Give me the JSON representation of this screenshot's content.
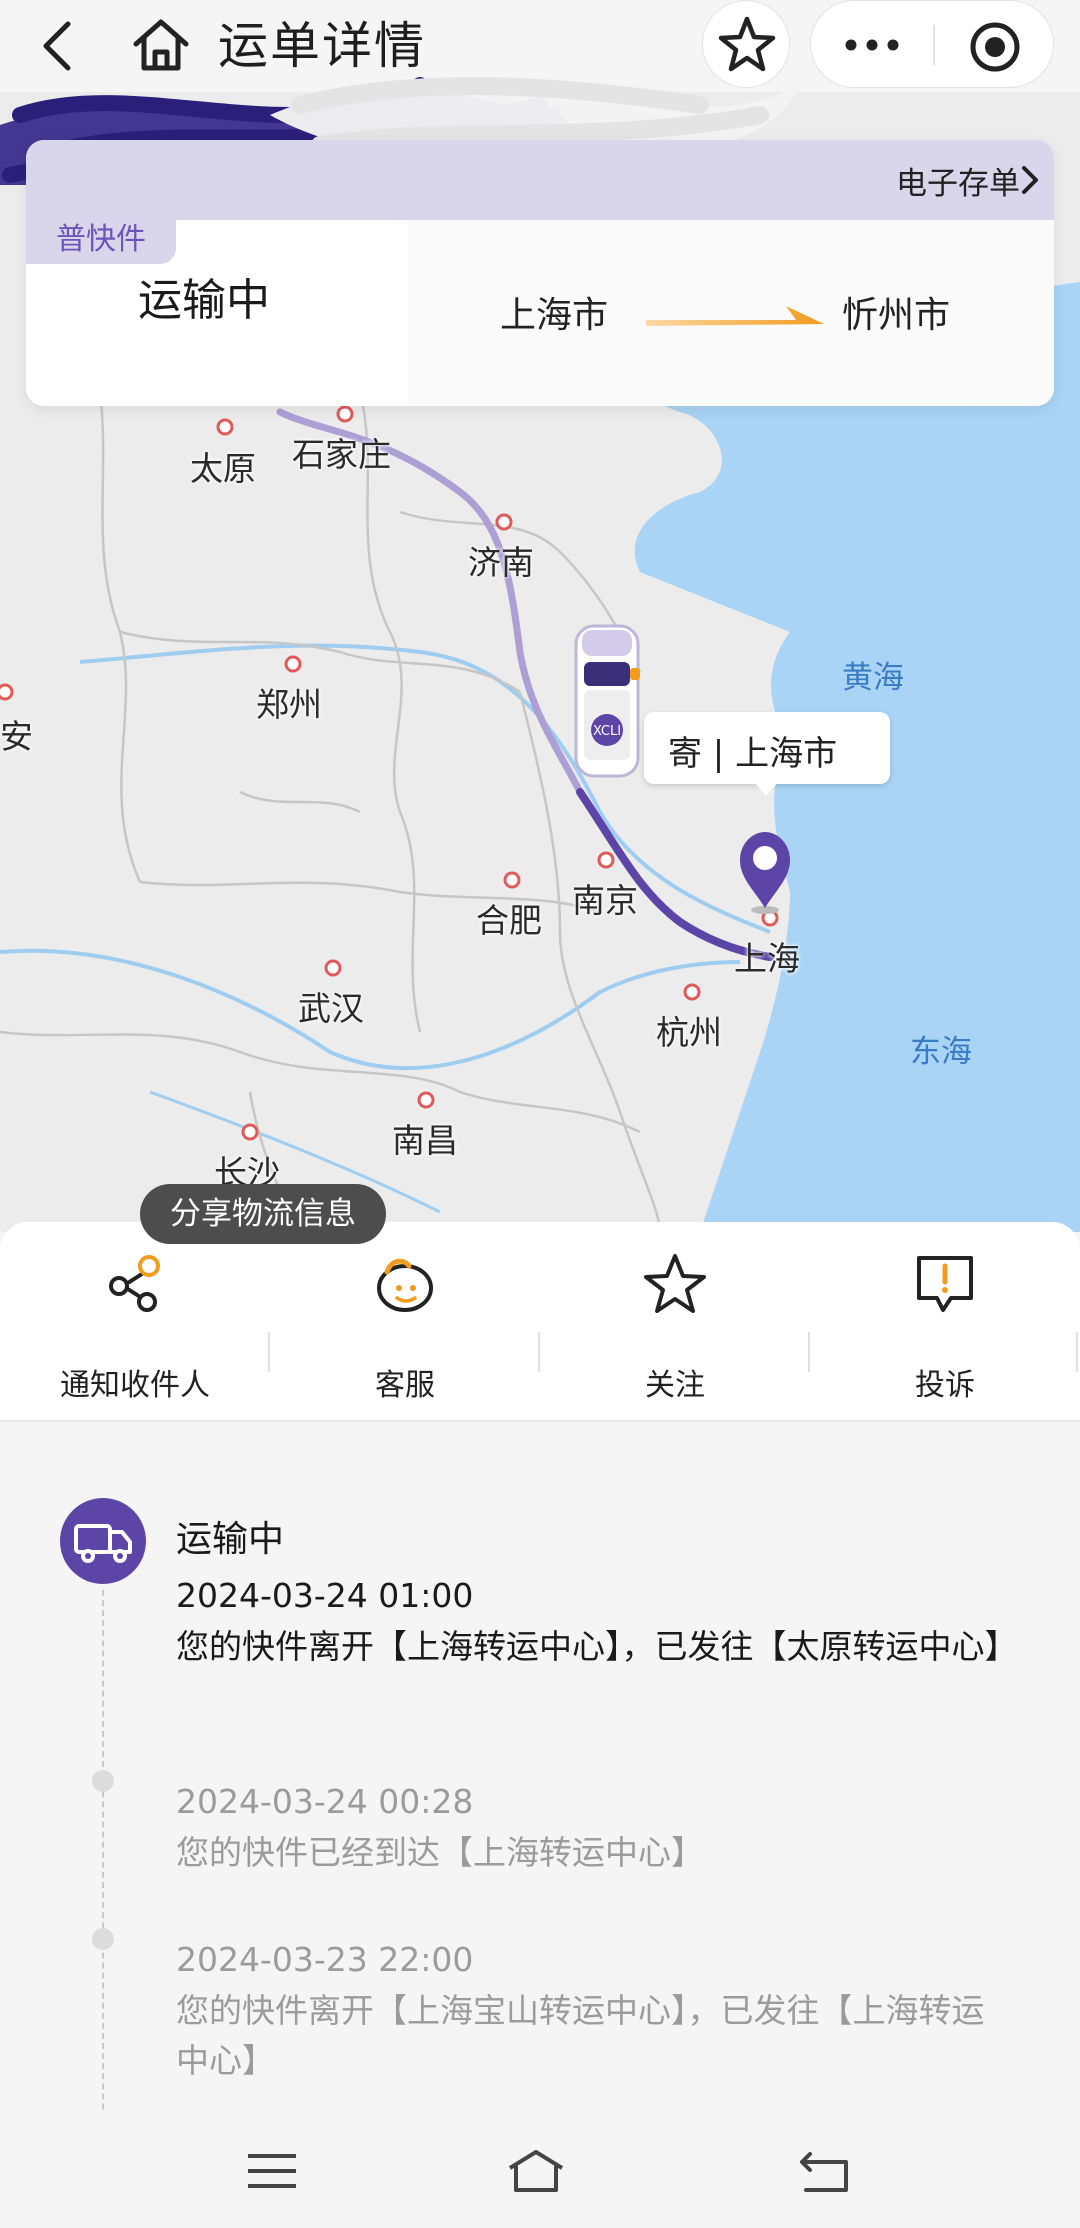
{
  "header": {
    "title": "运单详情"
  },
  "status_card": {
    "e_store_label": "电子存单",
    "service_tag": "普快件",
    "status": "运输中",
    "from_city": "上海市",
    "to_city": "忻州市"
  },
  "map": {
    "cities": [
      {
        "name": "太原"
      },
      {
        "name": "石家庄"
      },
      {
        "name": "济南"
      },
      {
        "name": "郑州"
      },
      {
        "name": "安"
      },
      {
        "name": "合肥"
      },
      {
        "name": "南京"
      },
      {
        "name": "上海"
      },
      {
        "name": "武汉"
      },
      {
        "name": "杭州"
      },
      {
        "name": "南昌"
      },
      {
        "name": "长沙"
      }
    ],
    "seas": [
      {
        "name": "黄海"
      },
      {
        "name": "东海"
      }
    ],
    "sender_label": "寄 | 上海市"
  },
  "share_tip": "分享物流信息",
  "actions": [
    {
      "label": "通知收件人",
      "icon": "share-icon"
    },
    {
      "label": "客服",
      "icon": "customer-service-icon"
    },
    {
      "label": "关注",
      "icon": "star-icon"
    },
    {
      "label": "投诉",
      "icon": "complaint-icon"
    }
  ],
  "timeline": {
    "current_status": "运输中",
    "events": [
      {
        "time": "2024-03-24 01:00",
        "desc": "您的快件离开【上海转运中心】，已发往【太原转运中心】"
      },
      {
        "time": "2024-03-24 00:28",
        "desc": "您的快件已经到达【上海转运中心】"
      },
      {
        "time": "2024-03-23 22:00",
        "desc": "您的快件离开【上海宝山转运中心】，已发往【上海转运中心】"
      }
    ]
  },
  "colors": {
    "brand_purple": "#5d45a8",
    "accent_orange": "#f29b1d",
    "sea_blue": "#a9d4f5"
  }
}
